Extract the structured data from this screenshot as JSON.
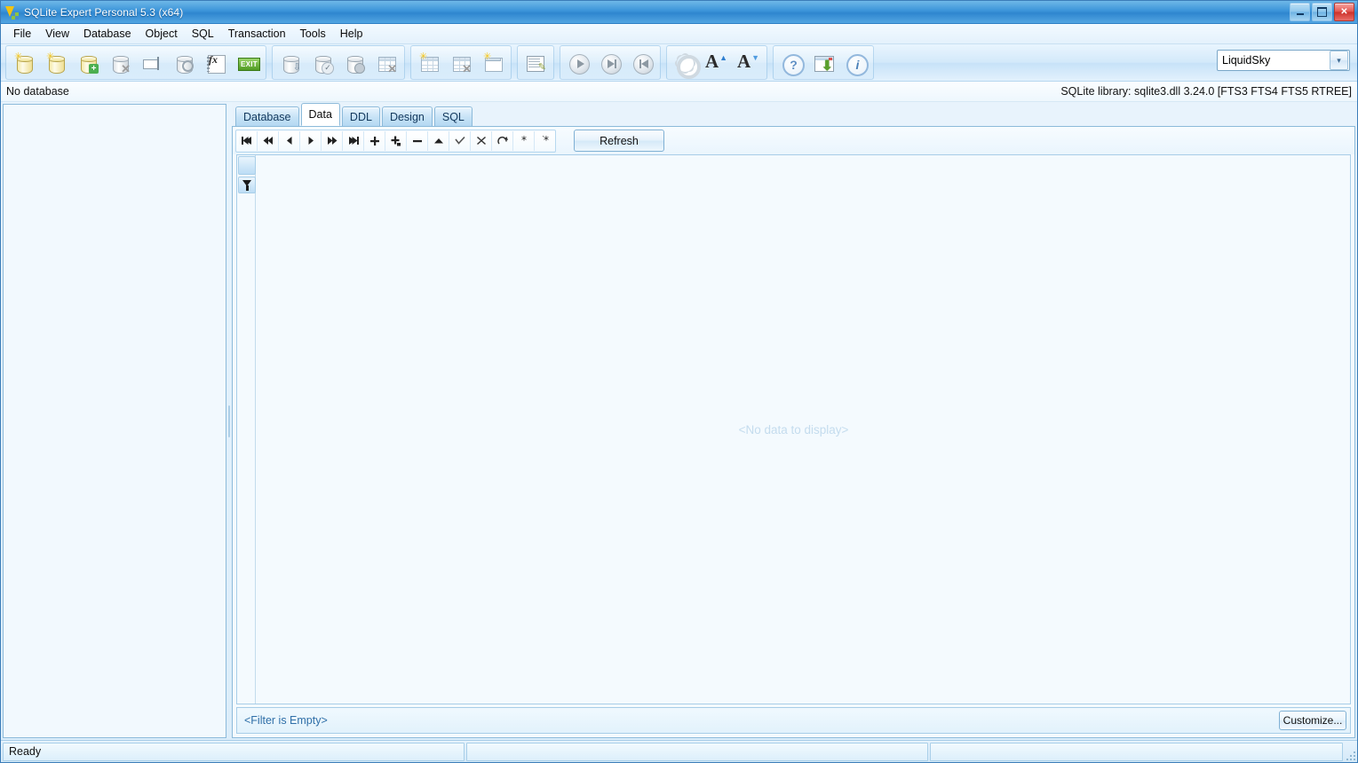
{
  "window": {
    "title": "SQLite Expert Personal 5.3 (x64)",
    "app_icon": "sqlite-expert-logo-icon",
    "controls": {
      "minimize": "minimize-icon",
      "maximize": "maximize-icon",
      "close": "✕"
    }
  },
  "menubar": {
    "items": [
      {
        "label": "File"
      },
      {
        "label": "View"
      },
      {
        "label": "Database"
      },
      {
        "label": "Object"
      },
      {
        "label": "SQL"
      },
      {
        "label": "Transaction"
      },
      {
        "label": "Tools"
      },
      {
        "label": "Help"
      }
    ]
  },
  "toolbar": {
    "groups": [
      {
        "name": "database-group",
        "buttons": [
          {
            "name": "open-database-button",
            "icon": "database-open-icon"
          },
          {
            "name": "recent-database-button",
            "icon": "database-recent-icon"
          },
          {
            "name": "new-database-button",
            "icon": "database-add-icon"
          },
          {
            "name": "close-database-button",
            "icon": "database-delete-icon"
          },
          {
            "name": "rename-database-button",
            "icon": "database-rename-icon"
          },
          {
            "name": "attach-database-button",
            "icon": "database-attach-icon"
          },
          {
            "name": "function-editor-button",
            "icon": "function-fx-icon"
          },
          {
            "name": "exit-button",
            "icon": "exit-icon",
            "label": "EXIT"
          }
        ]
      },
      {
        "name": "backup-group",
        "buttons": [
          {
            "name": "backup-database-button",
            "icon": "database-backup-icon"
          },
          {
            "name": "check-integrity-button",
            "icon": "database-check-icon"
          },
          {
            "name": "database-properties-button",
            "icon": "database-properties-icon"
          },
          {
            "name": "drop-tables-button",
            "icon": "table-drop-icon"
          }
        ]
      },
      {
        "name": "table-group",
        "buttons": [
          {
            "name": "new-table-button",
            "icon": "table-new-icon"
          },
          {
            "name": "delete-table-button",
            "icon": "table-delete-icon"
          },
          {
            "name": "new-view-button",
            "icon": "view-new-icon"
          }
        ]
      },
      {
        "name": "sql-group",
        "buttons": [
          {
            "name": "new-sql-tab-button",
            "icon": "sql-editor-icon"
          }
        ]
      },
      {
        "name": "execute-group",
        "buttons": [
          {
            "name": "execute-sql-button",
            "icon": "play-icon"
          },
          {
            "name": "execute-step-button",
            "icon": "play-to-end-icon"
          },
          {
            "name": "execute-rewind-button",
            "icon": "rewind-icon"
          }
        ]
      },
      {
        "name": "options-group",
        "buttons": [
          {
            "name": "options-button",
            "icon": "gear-icon"
          },
          {
            "name": "increase-font-button",
            "icon": "font-increase-icon"
          },
          {
            "name": "decrease-font-button",
            "icon": "font-decrease-icon"
          }
        ]
      },
      {
        "name": "help-group",
        "buttons": [
          {
            "name": "help-button",
            "icon": "question-mark-icon"
          },
          {
            "name": "check-updates-button",
            "icon": "download-update-icon"
          },
          {
            "name": "about-button",
            "icon": "info-icon"
          }
        ]
      }
    ],
    "theme_selector": {
      "value": "LiquidSky",
      "icon": "chevron-down-icon"
    }
  },
  "sidebar": {
    "header": "No database",
    "items": []
  },
  "library_info": "SQLite library: sqlite3.dll 3.24.0 [FTS3 FTS4 FTS5 RTREE]",
  "tabs": [
    {
      "label": "Database",
      "active": false
    },
    {
      "label": "Data",
      "active": true
    },
    {
      "label": "DDL",
      "active": false
    },
    {
      "label": "Design",
      "active": false
    },
    {
      "label": "SQL",
      "active": false
    }
  ],
  "data_tab": {
    "nav_buttons": [
      {
        "name": "first-record-button",
        "icon": "skip-to-first-icon"
      },
      {
        "name": "prior-page-button",
        "icon": "fast-rewind-icon"
      },
      {
        "name": "prior-record-button",
        "icon": "step-back-icon"
      },
      {
        "name": "next-record-button",
        "icon": "step-forward-icon"
      },
      {
        "name": "next-page-button",
        "icon": "fast-forward-icon"
      },
      {
        "name": "last-record-button",
        "icon": "skip-to-last-icon"
      },
      {
        "name": "insert-record-button",
        "icon": "plus-icon"
      },
      {
        "name": "duplicate-record-button",
        "icon": "plus-copy-icon"
      },
      {
        "name": "delete-record-button",
        "icon": "minus-icon"
      },
      {
        "name": "edit-record-button",
        "icon": "caret-up-icon"
      },
      {
        "name": "post-edit-button",
        "icon": "check-icon"
      },
      {
        "name": "cancel-edit-button",
        "icon": "x-icon"
      },
      {
        "name": "refresh-record-button",
        "icon": "refresh-arrow-icon"
      },
      {
        "name": "clear-value-button",
        "icon": "asterisk-icon"
      },
      {
        "name": "set-null-button",
        "icon": "asterisk-quote-icon"
      }
    ],
    "refresh_label": "Refresh",
    "grid": {
      "header_icon": "filter-funnel-icon",
      "empty_message": "<No data to display>"
    },
    "filter": {
      "text": "<Filter is Empty>",
      "customize_label": "Customize..."
    }
  },
  "statusbar": {
    "panel1": "Ready",
    "panel2": "",
    "panel3": "",
    "gripper": "resize-gripper-icon"
  }
}
